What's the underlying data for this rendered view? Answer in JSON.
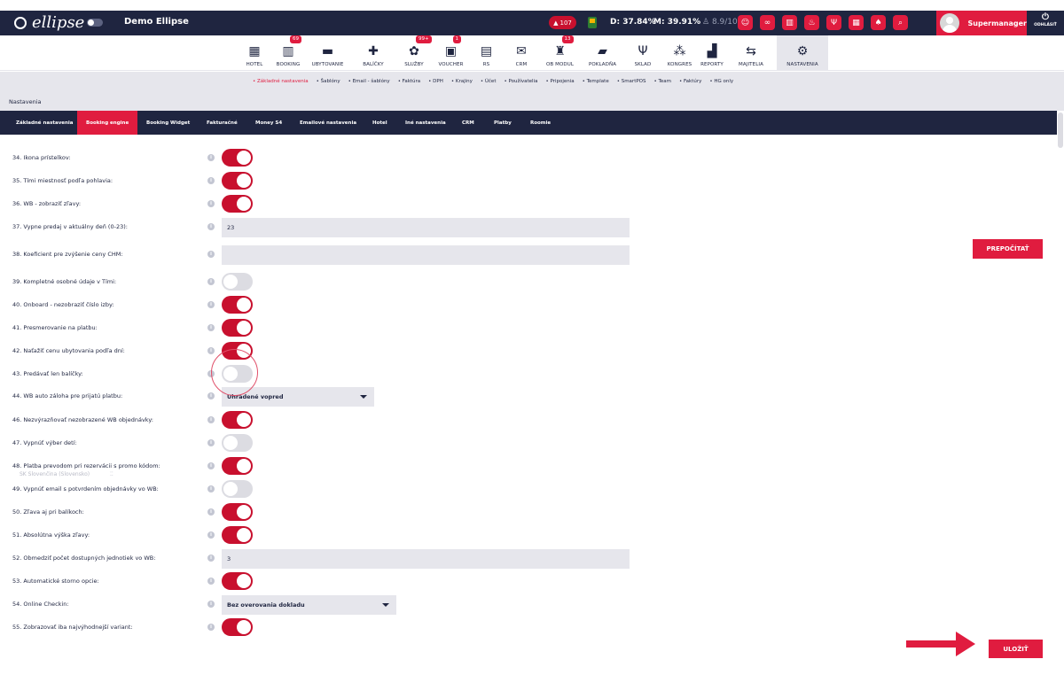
{
  "app": {
    "logo_text": "ellipse",
    "hotel_name": "Demo Ellipse",
    "alert_count": "107",
    "stats": {
      "d": "D: 37.84%",
      "m": "M: 39.91%",
      "rating": "8.9/10"
    },
    "user_name": "Supermanager",
    "logout_label": "ODHLÁSIŤ"
  },
  "top_icons": [
    "face-icon",
    "binoculars-icon",
    "chart-icon",
    "cake-icon",
    "fork-knife-icon",
    "calendar-icon",
    "fire-icon",
    "search-icon"
  ],
  "modules": [
    {
      "label": "HOTEL",
      "icon": "▦",
      "badge": ""
    },
    {
      "label": "BOOKING",
      "icon": "▥",
      "badge": "69"
    },
    {
      "label": "UBYTOVANIE",
      "icon": "▬",
      "badge": ""
    },
    {
      "label": "BALÍČKY",
      "icon": "✚",
      "badge": ""
    },
    {
      "label": "SLUŽBY",
      "icon": "✿",
      "badge": "99+"
    },
    {
      "label": "VOUCHER",
      "icon": "▣",
      "badge": "1"
    },
    {
      "label": "RS",
      "icon": "▤",
      "badge": ""
    },
    {
      "label": "CRM",
      "icon": "✉",
      "badge": ""
    },
    {
      "label": "OB MODUL",
      "icon": "♜",
      "badge": "13"
    },
    {
      "label": "POKLADŇA",
      "icon": "▰",
      "badge": ""
    },
    {
      "label": "SKLAD",
      "icon": "Ψ",
      "badge": ""
    },
    {
      "label": "KONGRES",
      "icon": "⁂",
      "badge": ""
    },
    {
      "label": "REPORTY",
      "icon": "▟",
      "badge": ""
    },
    {
      "label": "MAJITELIA",
      "icon": "⇆",
      "badge": ""
    },
    {
      "label": "NASTAVENIA",
      "icon": "⚙",
      "badge": ""
    }
  ],
  "sublinks": [
    "• Základné nastavenia",
    "• Šablóny",
    "• Email - šablóny",
    "• Faktúra",
    "• DPH",
    "• Krajiny",
    "• Účet",
    "• Používatelia",
    "• Pripojenia",
    "• Template",
    "• SmartPOS",
    "• Team",
    "• Faktúry",
    "• HG only"
  ],
  "breadcrumb": "Nastavenia",
  "tabs": [
    "Základné nastavenia",
    "Booking engine",
    "Booking Widget",
    "Fakturačné",
    "Money S4",
    "Emailové nastavenia",
    "Hotel",
    "Iné nastavenia",
    "CRM",
    "Platby",
    "Roomie"
  ],
  "settings": [
    {
      "label": "34. Ikona prístelkov:",
      "type": "toggle",
      "on": true
    },
    {
      "label": "35. Tími miestnosť podľa pohlavia:",
      "type": "toggle",
      "on": true
    },
    {
      "label": "36. WB - zobraziť zľavy:",
      "type": "toggle",
      "on": true
    },
    {
      "label": "37. Vypne predaj v aktuálny deň (0-23):",
      "type": "text",
      "value": "23"
    },
    {
      "label": "38. Koeficient pre zvýšenie ceny CHM:",
      "type": "text",
      "value": ""
    },
    {
      "label": "39. Kompletné osobné údaje v Tími:",
      "type": "toggle",
      "on": false
    },
    {
      "label": "40. Onboard - nezobraziť číslo izby:",
      "type": "toggle",
      "on": true
    },
    {
      "label": "41. Presmerovanie na platbu:",
      "type": "toggle",
      "on": true
    },
    {
      "label": "42. Naťažiť cenu ubytovania podľa dní:",
      "type": "toggle",
      "on": true
    },
    {
      "label": "43. Predávať len balíčky:",
      "type": "toggle",
      "on": false
    },
    {
      "label": "44. WB auto záloha pre prijatú platbu:",
      "type": "select",
      "value": "Uhradené vopred"
    },
    {
      "label": "46. Nezvýrazňovať nezobrazené WB objednávky:",
      "type": "toggle",
      "on": true
    },
    {
      "label": "47. Vypnúť výber detí:",
      "type": "toggle",
      "on": false
    },
    {
      "label": "48. Platba prevodom pri rezervácii s promo kódom:",
      "type": "toggle",
      "on": true
    },
    {
      "label": "49. Vypnúť email s potvrdením objednávky vo WB:",
      "type": "toggle",
      "on": false
    },
    {
      "label": "50. Zľava aj pri balíkoch:",
      "type": "toggle",
      "on": true
    },
    {
      "label": "51. Absolútna výška zľavy:",
      "type": "toggle",
      "on": true
    },
    {
      "label": "52. Obmedziť počet dostupných jednotiek vo WB:",
      "type": "text",
      "value": "3"
    },
    {
      "label": "53. Automatické storno opcie:",
      "type": "toggle",
      "on": true
    },
    {
      "label": "54. Online Checkin:",
      "type": "select",
      "value": "Bez overovania dokladu"
    },
    {
      "label": "55. Zobrazovať iba najvýhodnejší variant:",
      "type": "toggle",
      "on": true
    }
  ],
  "ghost_language": "SK Slovenčina (Slovensko)",
  "ghost_dots": "⁚⁚",
  "buttons": {
    "recalc": "PREPOČÍTAŤ",
    "save": "ULOŽIŤ"
  },
  "colors": {
    "navy": "#1f2540",
    "accent": "#e01c3f",
    "toggle_on": "#c8102e",
    "toggle_off": "#dcdce2",
    "panel": "#e6e6ec"
  }
}
